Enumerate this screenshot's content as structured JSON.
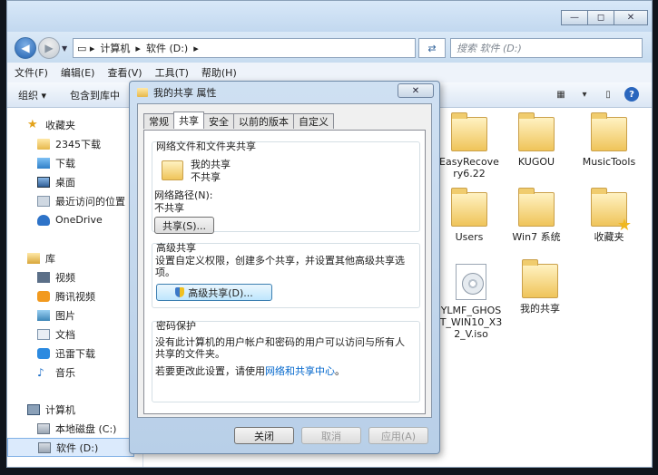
{
  "window": {
    "controls": [
      "—",
      "◻",
      "✕"
    ]
  },
  "nav": {
    "path": [
      "计算机",
      "软件 (D:)"
    ],
    "search_placeholder": "搜索 软件 (D:)"
  },
  "menu": [
    "文件(F)",
    "编辑(E)",
    "查看(V)",
    "工具(T)",
    "帮助(H)"
  ],
  "commands": {
    "organize": "组织 ▾",
    "include": "包含到库中"
  },
  "sidebar": {
    "favorites": {
      "label": "收藏夹",
      "items": [
        "2345下载",
        "下载",
        "桌面",
        "最近访问的位置",
        "OneDrive"
      ]
    },
    "libraries": {
      "label": "库",
      "items": [
        "视频",
        "腾讯视频",
        "图片",
        "文档",
        "迅雷下载",
        "音乐"
      ]
    },
    "computer": {
      "label": "计算机",
      "items": [
        "本地磁盘 (C:)",
        "软件 (D:)"
      ]
    }
  },
  "files": [
    "EasyRecovery6.22",
    "KUGOU",
    "MusicTools",
    "Users",
    "Win7 系统",
    "收藏夹",
    "YLMF_GHOST_WIN10_X32_V.iso",
    "我的共享"
  ],
  "dialog": {
    "title": "我的共享 属性",
    "close": "✕",
    "tabs": [
      "常规",
      "共享",
      "安全",
      "以前的版本",
      "自定义"
    ],
    "network_group": {
      "title": "网络文件和文件夹共享",
      "name": "我的共享",
      "status": "不共享",
      "path_label": "网络路径(N):",
      "path_value": "不共享",
      "share_button": "共享(S)..."
    },
    "advanced_group": {
      "title": "高级共享",
      "description": "设置自定义权限，创建多个共享，并设置其他高级共享选项。",
      "button": "高级共享(D)..."
    },
    "password_group": {
      "title": "密码保护",
      "description": "没有此计算机的用户帐户和密码的用户可以访问与所有人共享的文件夹。",
      "change_prefix": "若要更改此设置，请使用",
      "link": "网络和共享中心",
      "change_suffix": "。"
    },
    "buttons": {
      "close": "关闭",
      "cancel": "取消",
      "apply": "应用(A)"
    }
  }
}
